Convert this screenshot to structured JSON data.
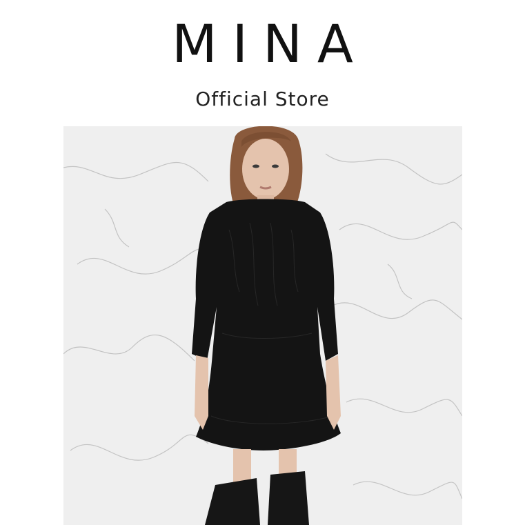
{
  "brand": {
    "name": "MINA",
    "subtitle": "Official Store"
  },
  "photo": {
    "background_color": "#eeeeee",
    "dress_color": "#141414",
    "skin_color": "#e4c3ad",
    "hair_color": "#8a5a3c"
  }
}
